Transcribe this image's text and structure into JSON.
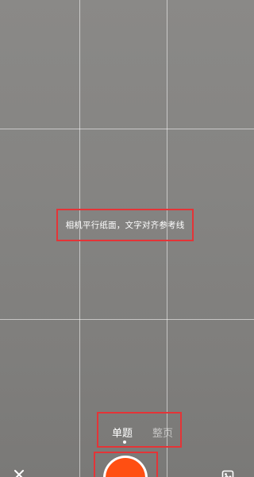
{
  "camera": {
    "hint_text": "相机平行纸面，文字对齐参考线"
  },
  "modes": {
    "tabs": [
      {
        "label": "单题",
        "active": true
      },
      {
        "label": "整页",
        "active": false
      }
    ]
  },
  "controls": {
    "close_icon": "close-icon",
    "gallery_icon": "image-gallery-icon",
    "shutter_color": "#ff4f12",
    "highlight_color": "#e43437"
  }
}
